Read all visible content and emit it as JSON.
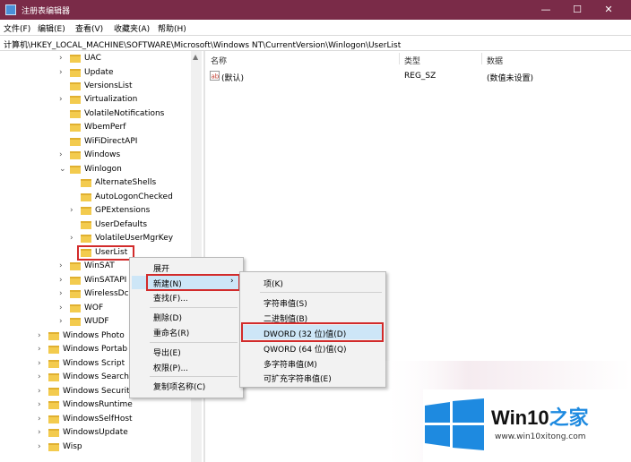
{
  "window": {
    "title": "注册表编辑器",
    "controls": [
      "—",
      "☐",
      "✕"
    ]
  },
  "menubar": [
    "文件(F)",
    "编辑(E)",
    "查看(V)",
    "收藏夹(A)",
    "帮助(H)"
  ],
  "address": "计算机\\HKEY_LOCAL_MACHINE\\SOFTWARE\\Microsoft\\Windows NT\\CurrentVersion\\Winlogon\\UserList",
  "tree": [
    {
      "label": "UAC",
      "expander": "›"
    },
    {
      "label": "Update",
      "expander": "›"
    },
    {
      "label": "VersionsList",
      "expander": ""
    },
    {
      "label": "Virtualization",
      "expander": "›"
    },
    {
      "label": "VolatileNotifications",
      "expander": ""
    },
    {
      "label": "WbemPerf",
      "expander": ""
    },
    {
      "label": "WiFiDirectAPI",
      "expander": ""
    },
    {
      "label": "Windows",
      "expander": "›"
    },
    {
      "label": "Winlogon",
      "expander": "⌄"
    },
    {
      "label": "AlternateShells",
      "expander": ""
    },
    {
      "label": "AutoLogonChecked",
      "expander": ""
    },
    {
      "label": "GPExtensions",
      "expander": "›"
    },
    {
      "label": "UserDefaults",
      "expander": ""
    },
    {
      "label": "VolatileUserMgrKey",
      "expander": "›"
    },
    {
      "label": "UserList",
      "expander": ""
    },
    {
      "label": "WinSAT",
      "expander": "›"
    },
    {
      "label": "WinSATAPI",
      "expander": "›"
    },
    {
      "label": "WirelessDc",
      "expander": "›"
    },
    {
      "label": "WOF",
      "expander": "›"
    },
    {
      "label": "WUDF",
      "expander": "›"
    },
    {
      "label": "Windows Photo",
      "expander": "›"
    },
    {
      "label": "Windows Portab",
      "expander": "›"
    },
    {
      "label": "Windows Script",
      "expander": "›"
    },
    {
      "label": "Windows Search",
      "expander": "›"
    },
    {
      "label": "Windows Securit",
      "expander": "›"
    },
    {
      "label": "WindowsRuntime",
      "expander": "›"
    },
    {
      "label": "WindowsSelfHost",
      "expander": "›"
    },
    {
      "label": "WindowsUpdate",
      "expander": "›"
    },
    {
      "label": "Wisp",
      "expander": "›"
    }
  ],
  "list": {
    "headers": [
      "名称",
      "类型",
      "数据"
    ],
    "rows": [
      {
        "name": "(默认)",
        "type": "REG_SZ",
        "data": "(数值未设置)"
      }
    ]
  },
  "context_menu": {
    "items": [
      "展开",
      "新建(N)",
      "查找(F)...",
      "删除(D)",
      "重命名(R)",
      "导出(E)",
      "权限(P)...",
      "复制项名称(C)"
    ],
    "arrow": "›"
  },
  "submenu": {
    "items": [
      "项(K)",
      "字符串值(S)",
      "二进制值(B)",
      "DWORD (32 位)值(D)",
      "QWORD (64 位)值(Q)",
      "多字符串值(M)",
      "可扩充字符串值(E)"
    ]
  },
  "watermark": {
    "brand": "Win10",
    "brand_suffix": "之家",
    "url": "www.win10xitong.com"
  },
  "colors": {
    "titlebar": "#7a2b48",
    "highlight_red": "#d22b2b",
    "selection_blue": "#cde6f7",
    "win_logo_blue": "#1e8ae0"
  }
}
